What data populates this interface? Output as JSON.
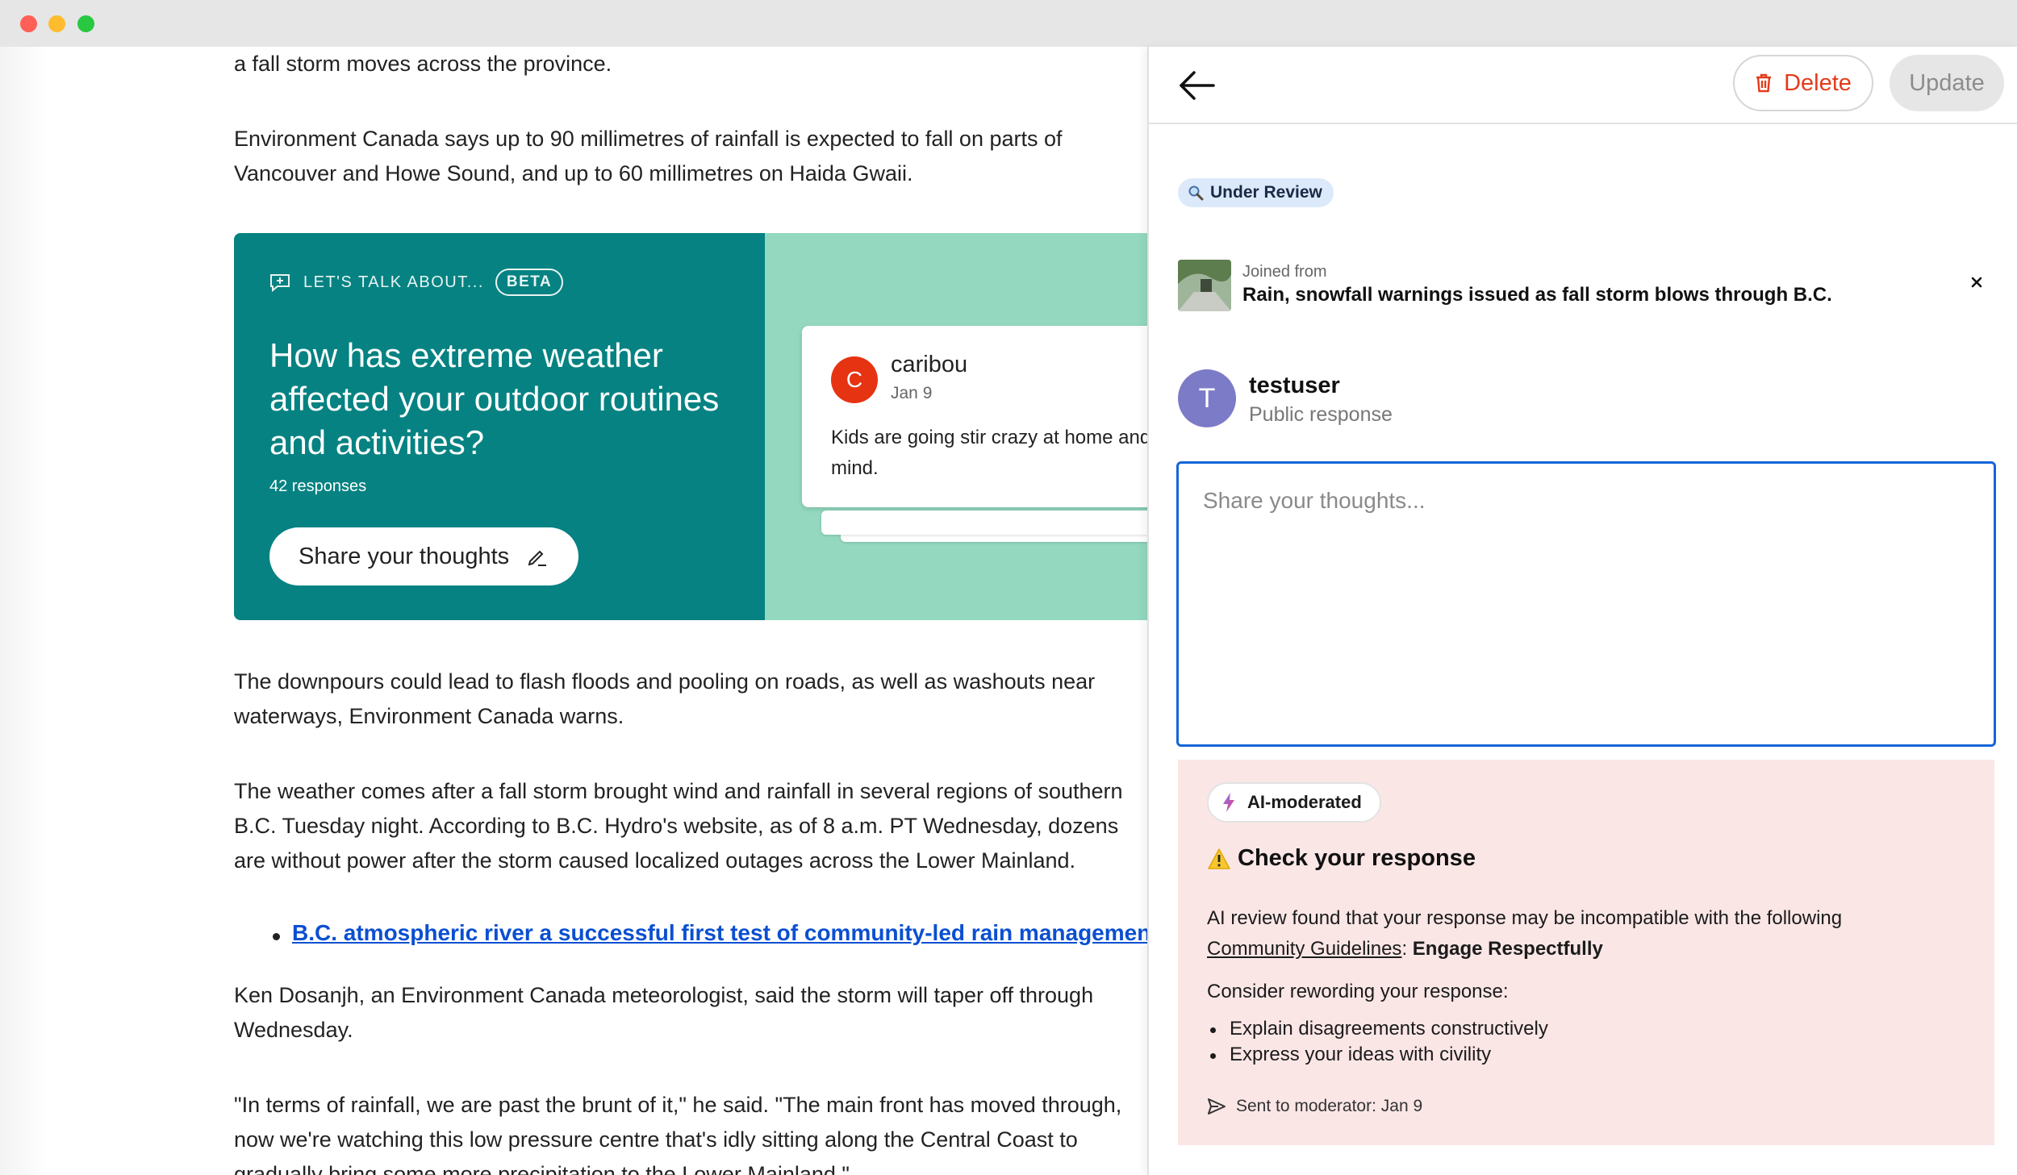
{
  "article": {
    "p1": "a fall storm moves across the province.",
    "p2_line1": "Environment Canada says up to 90 millimetres of rainfall is expected to fall on parts of",
    "p2_line2": "Vancouver and Howe Sound, and up to 60 millimetres on Haida Gwaii.",
    "p3_line1": "The downpours could lead to flash floods and pooling on roads, as well as washouts near",
    "p3_line2": "waterways, Environment Canada warns.",
    "p4_line1": "The weather comes after a fall storm brought wind and rainfall in several regions of southern",
    "p4_line2": "B.C. Tuesday night. According to B.C. Hydro's website, as of 8 a.m. PT Wednesday, dozens",
    "p4_line3": "are without power after the storm caused localized outages across the Lower Mainland.",
    "link": "B.C. atmospheric river a successful first test of community-led rain management",
    "p5_line1": "Ken Dosanjh, an Environment Canada meteorologist, said the storm will taper off through",
    "p5_line2": "Wednesday.",
    "p6_line1": "\"In terms of rainfall, we are past the brunt of it,\" he said. \"The main front has moved through,",
    "p6_line2": "now we're watching this low pressure centre that's idly sitting along the Central Coast to",
    "p6_line3": "gradually bring some more precipitation to the Lower Mainland.\""
  },
  "widget": {
    "kicker": "LET'S TALK ABOUT...",
    "beta": "BETA",
    "question": "How has extreme weather affected your outdoor routines and activities?",
    "responses": "42 responses",
    "share_label": "Share your thoughts",
    "card": {
      "avatar_letter": "C",
      "user": "caribou",
      "date": "Jan 9",
      "text": "Kids are going stir crazy at home and I'm losing my mind."
    }
  },
  "panel": {
    "delete_label": "Delete",
    "update_label": "Update",
    "status_badge": "Under Review",
    "joined_label": "Joined from",
    "joined_title": "Rain, snowfall warnings issued as fall storm blows through B.C.",
    "avatar_letter": "T",
    "username": "testuser",
    "visibility": "Public response",
    "placeholder": "Share your thoughts...",
    "moderation": {
      "badge": "AI-moderated",
      "title": "Check your response",
      "text_prefix": "AI review found that your response may be incompatible with the following",
      "guidelines_link": "Community Guidelines",
      "guideline_sep": ":",
      "guideline": "Engage Respectfully",
      "reword_intro": "Consider rewording your response:",
      "tips": [
        "Explain disagreements constructively",
        "Express your ideas with civility"
      ],
      "sent": "Sent to moderator: Jan 9"
    }
  },
  "colors": {
    "widget_teal": "#068282",
    "widget_mint": "#93d8bf",
    "link_blue": "#0b4fd1",
    "delete_red": "#e43b1a",
    "focus_blue": "#1565d8",
    "warn_bg": "#fbe6e6",
    "avatar_purple": "#7c7bc7",
    "badge_blue": "#dce9fb"
  }
}
